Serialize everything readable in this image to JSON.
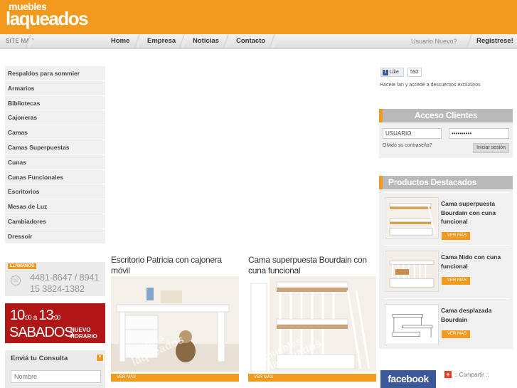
{
  "brand": {
    "logo_line1": "muebles",
    "logo_line2": "laqueados"
  },
  "nav": {
    "sitemap": "SITE MAP",
    "items": [
      "Home",
      "Empresa",
      "Noticias",
      "Contacto"
    ],
    "user_new": "Usuario Nuevo?",
    "register": "Registrese!"
  },
  "sidebar": {
    "categories": [
      "Respaldos para sommier",
      "Armarios",
      "Bibliotecas",
      "Cajoneras",
      "Camas",
      "Camas Superpuestas",
      "Cunas",
      "Cunas Funcionales",
      "Escritorios",
      "Mesas de Luz",
      "Cambiadores",
      "Dressoir"
    ]
  },
  "contact": {
    "tag": "LLAMANOS",
    "phone_line1": "4481-8647 / 8941",
    "phone_line2": "15 3824-1382"
  },
  "hours": {
    "from": "10",
    "from_min": ":00",
    "a": "a",
    "to": "13",
    "to_min": ":00",
    "days": "SABADOS",
    "nuevo": "NUEVO",
    "horario": "HORARIO"
  },
  "consulta": {
    "title": "Enviá tu Consulta",
    "placeholder": "Nombre"
  },
  "products": [
    {
      "title": "Escritorio Patricia con cajonera móvil",
      "cta": "VER MÁS"
    },
    {
      "title": "Cama superpuesta Bourdain con cuna funcional",
      "cta": "VER MÁS"
    }
  ],
  "facebook": {
    "like": "Like",
    "count": "592",
    "fan_text": "Hacete fan y accedé a descuentos exclusivos",
    "logo": "facebook"
  },
  "clientes": {
    "title": "Acceso Clientes",
    "user_value": "USUARIO",
    "pass_value": "••••••••••",
    "forgot": "Olvidó su contraseña?",
    "login": "Iniciar sesión"
  },
  "destacados": {
    "title": "Productos Destacados",
    "items": [
      {
        "name": "Cama superpuesta Bourdain con cuna funcional",
        "cta": "VER MÁS"
      },
      {
        "name": "Cama Nido con cuna funcional",
        "cta": "VER MÁS"
      },
      {
        "name": "Cama desplazada Bourdain",
        "cta": "VER MÁS"
      }
    ]
  },
  "share": {
    "label": ":: Compartir ::"
  },
  "colors": {
    "brand_orange": "#f39a1e",
    "hours_red": "#b01616",
    "facebook_blue": "#3b5998"
  }
}
